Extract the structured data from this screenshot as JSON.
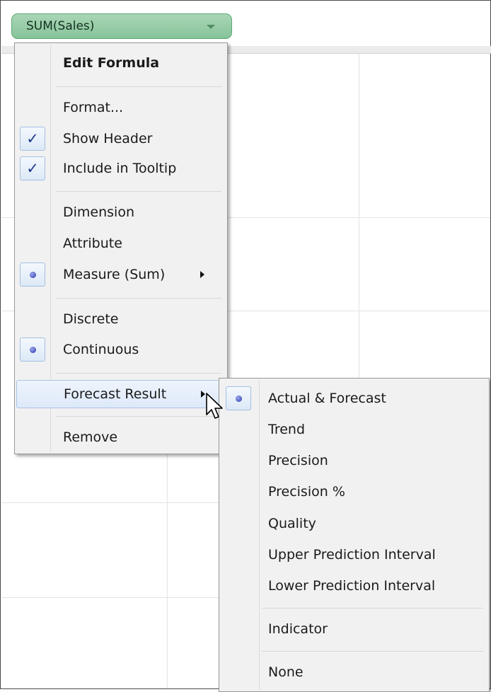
{
  "pill": {
    "label": "SUM(Sales)"
  },
  "main_menu": {
    "items": [
      {
        "label": "Edit Formula"
      },
      {
        "label": "Format..."
      },
      {
        "label": "Show Header",
        "checked": true
      },
      {
        "label": "Include in Tooltip",
        "checked": true
      },
      {
        "label": "Dimension"
      },
      {
        "label": "Attribute"
      },
      {
        "label": "Measure (Sum)",
        "selected": true,
        "has_submenu": true
      },
      {
        "label": "Discrete"
      },
      {
        "label": "Continuous",
        "selected": true
      },
      {
        "label": "Forecast Result",
        "has_submenu": true,
        "highlighted": true
      },
      {
        "label": "Remove"
      }
    ]
  },
  "sub_menu": {
    "items": [
      {
        "label": "Actual & Forecast",
        "selected": true
      },
      {
        "label": "Trend"
      },
      {
        "label": "Precision"
      },
      {
        "label": "Precision %"
      },
      {
        "label": "Quality"
      },
      {
        "label": "Upper Prediction Interval"
      },
      {
        "label": "Lower Prediction Interval"
      },
      {
        "label": "Indicator"
      },
      {
        "label": "None"
      }
    ]
  },
  "icons": {
    "checkmark": "check-icon",
    "radio": "bullet-icon",
    "submenu": "triangle-right-icon",
    "pill_dropdown": "caret-down-icon",
    "cursor": "mouse-pointer-icon"
  },
  "colors": {
    "pill_fill": "#96cba6",
    "pill_border": "#5aa772",
    "menu_bg": "#f1f1f1",
    "highlight_border": "#aac3e6",
    "bullet": "#2a36a8",
    "check": "#1e3c8e"
  }
}
